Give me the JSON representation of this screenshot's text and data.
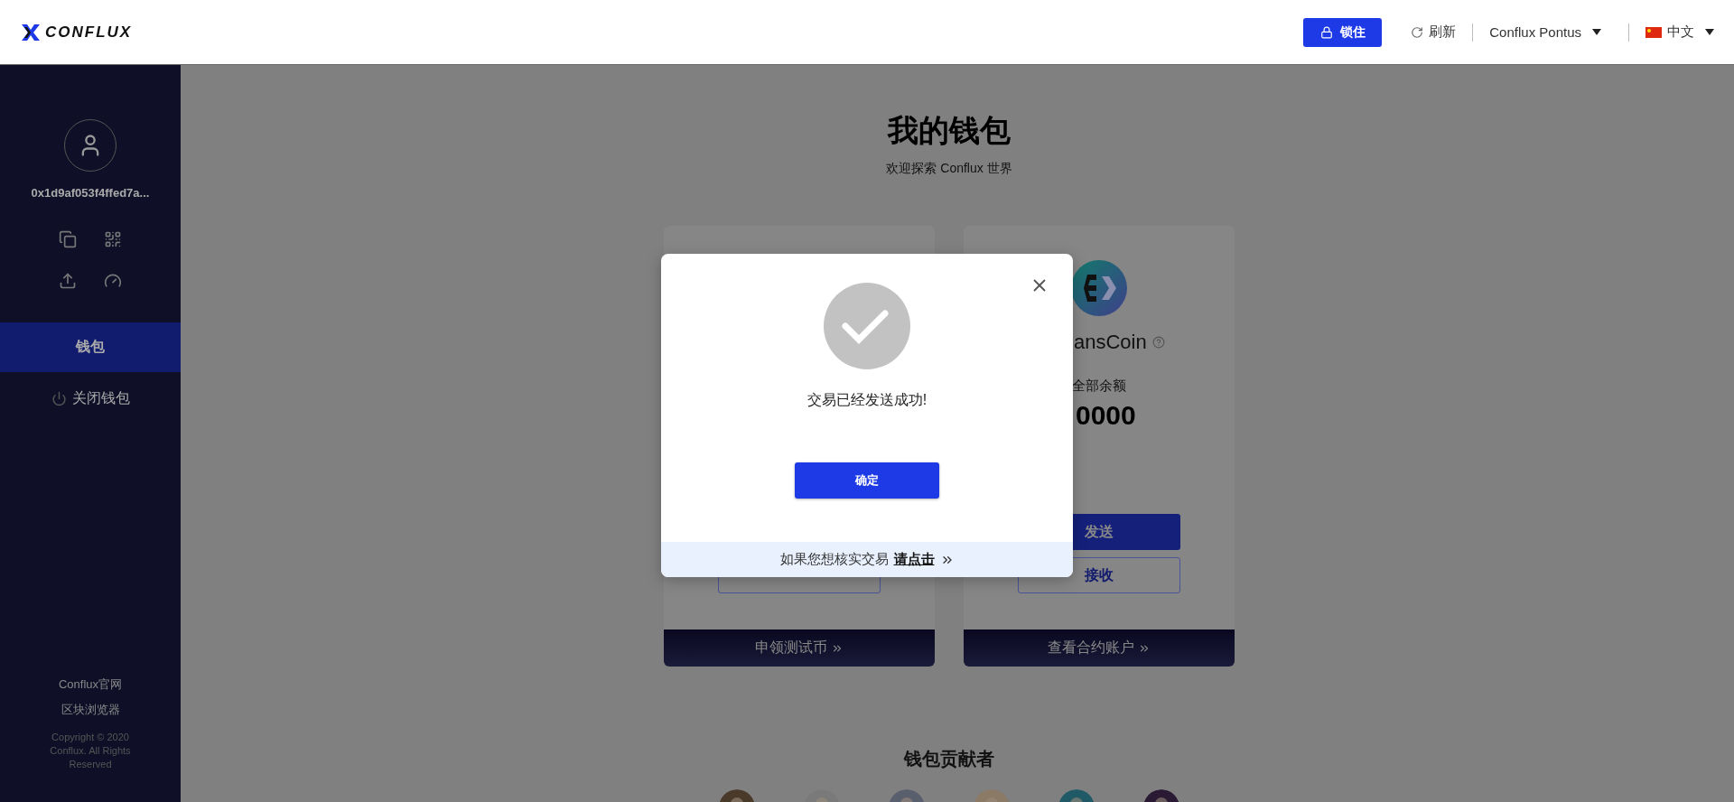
{
  "header": {
    "logo": "CONFLUX",
    "lock_button": "锁住",
    "refresh": "刷新",
    "network": "Conflux Pontus",
    "language": "中文"
  },
  "sidebar": {
    "address": "0x1d9af053f4ffed7a...",
    "nav": [
      {
        "label": "钱包",
        "selected": true,
        "kind": "plain"
      },
      {
        "label": "关闭钱包",
        "selected": false,
        "kind": "power"
      }
    ],
    "links": [
      "Conflux官网",
      "区块浏览器"
    ],
    "copyright": "Copyright © 2020 Conflux. All Rights Reserved"
  },
  "main": {
    "title": "我的钱包",
    "subtitle": "欢迎探索 Conflux 世界",
    "cards": [
      {
        "kind": "covered",
        "footer": "申领测试币"
      },
      {
        "kind": "token",
        "name": "ansCoin",
        "balance_label": "全部余额",
        "balance": "0000",
        "send": "发送",
        "receive": "接收",
        "footer": "查看合约账户"
      }
    ],
    "contributors_title": "钱包贡献者"
  },
  "modal": {
    "message": "交易已经发送成功!",
    "confirm": "确定",
    "footer_text": "如果您想核实交易",
    "footer_link": "请点击"
  }
}
